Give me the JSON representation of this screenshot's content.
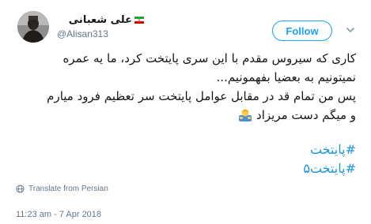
{
  "user": {
    "display_name": "علی شعبانی",
    "handle": "@Alisan313",
    "flag_colors": [
      "#239f40",
      "#ffffff",
      "#da0000"
    ]
  },
  "follow_button": {
    "label": "Follow"
  },
  "tweet": {
    "lines": [
      "کاری که سیروس مقدم با این سری پایتخت کرد، ما  یه عمره",
      "نمیتونیم به بعضیا بفهمونیم...",
      "پس من تمام قد در مقابل عوامل پایتخت سر تعظیم فرود میارم",
      "و میگم دست مریزاد"
    ],
    "emoji": "person-bowing-emoji",
    "hashtags": [
      "#پایتخت",
      "#پایتخت۵"
    ]
  },
  "translate": {
    "label": "Translate from Persian"
  },
  "meta": {
    "timestamp": "11:23 am - 7 Apr 2018"
  },
  "colors": {
    "accent": "#1da1f2",
    "hashtag": "#1b95e0",
    "secondary_text": "#657786",
    "primary_text": "#14171a"
  }
}
